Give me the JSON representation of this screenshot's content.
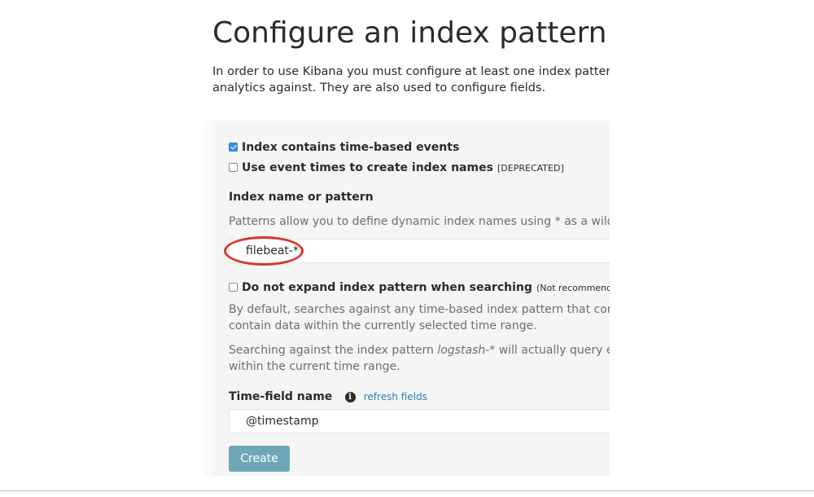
{
  "title": "Configure an index pattern",
  "intro": {
    "line1": "In order to use Kibana you must configure at least one index pattern. Index",
    "line2": "analytics against. They are also used to configure fields."
  },
  "form": {
    "time_based": {
      "label": "Index contains time-based events",
      "checked": true
    },
    "event_times": {
      "label": "Use event times to create index names",
      "note": "[DEPRECATED]",
      "checked": false
    },
    "index_label": "Index name or pattern",
    "index_help": "Patterns allow you to define dynamic index names using * as a wildcard",
    "index_value": "filebeat-*",
    "no_expand": {
      "label": "Do not expand index pattern when searching",
      "note": "(Not recommended)",
      "checked": false
    },
    "expand_help_1_line1": "By default, searches against any time-based index pattern that contains",
    "expand_help_1_line2": "contain data within the currently selected time range.",
    "expand_help_2_pre": "Searching against the index pattern ",
    "expand_help_2_italic": "logstash-*",
    "expand_help_2_post": " will actually query elastics",
    "expand_help_2_line2": "within the current time range.",
    "time_field_label": "Time-field name",
    "refresh_label": "refresh fields",
    "time_field_value": "@timestamp",
    "create_label": "Create"
  },
  "colors": {
    "accent": "#3a8ee6",
    "button": "#6fa7b8",
    "highlight": "#d9362b",
    "link": "#2f7fb3"
  },
  "icons": [
    "checkbox-checked-icon",
    "checkbox-icon",
    "info-icon"
  ]
}
